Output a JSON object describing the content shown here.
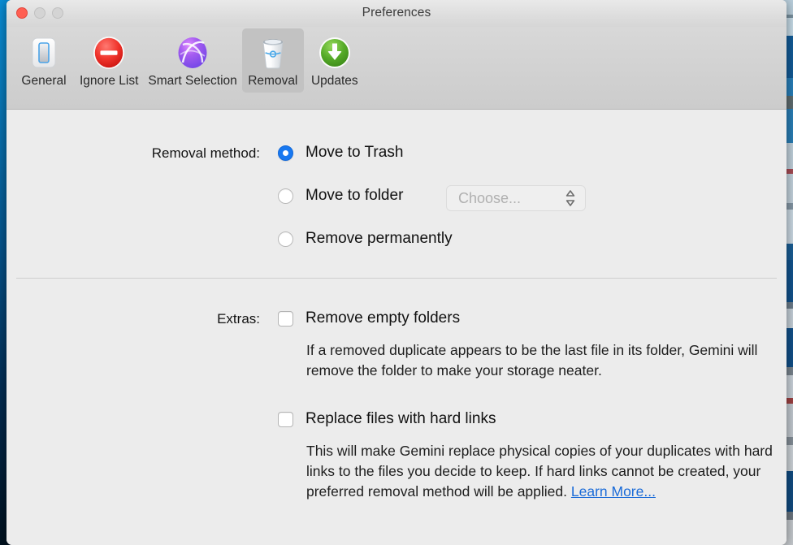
{
  "window": {
    "title": "Preferences",
    "traffic_lights": [
      {
        "name": "close",
        "color": "#ff5f52"
      },
      {
        "name": "minimize",
        "color": "#d4d4d4"
      },
      {
        "name": "zoom",
        "color": "#d4d4d4"
      }
    ]
  },
  "toolbar": {
    "items": [
      {
        "label": "General",
        "icon": "toggle-switch-icon",
        "selected": false
      },
      {
        "label": "Ignore List",
        "icon": "no-entry-sign-icon",
        "selected": false
      },
      {
        "label": "Smart Selection",
        "icon": "purple-orb-icon",
        "selected": false
      },
      {
        "label": "Removal",
        "icon": "trash-can-icon",
        "selected": true
      },
      {
        "label": "Updates",
        "icon": "green-download-icon",
        "selected": false
      }
    ]
  },
  "content": {
    "removal_method": {
      "label": "Removal method:",
      "selected": "Move to Trash",
      "options": [
        {
          "label": "Move to Trash",
          "checked": true
        },
        {
          "label": "Move to folder",
          "checked": false
        },
        {
          "label": "Remove permanently",
          "checked": false
        }
      ],
      "folder_popup": {
        "value": "Choose...",
        "enabled": false,
        "icon": "up-down-chevron-icon"
      }
    },
    "extras": {
      "label": "Extras:",
      "items": [
        {
          "label": "Remove empty folders",
          "checked": false,
          "help": "If a removed duplicate appears to be the last file in its folder, Gemini will remove the folder to make your storage neater."
        },
        {
          "label": "Replace files with hard links",
          "checked": false,
          "help": "This will make Gemini replace physical copies of your duplicates with hard links to the files you decide to keep. If hard links cannot be created, your preferred removal method will be applied. ",
          "link_label": "Learn More..."
        }
      ]
    }
  },
  "colors": {
    "accent_blue": "#1878f0",
    "link_blue": "#1a6bd8",
    "window_bg": "#ececec",
    "toolbar_bg": "#d2d2d2",
    "selected_tab_bg": "#c2c2c2"
  }
}
